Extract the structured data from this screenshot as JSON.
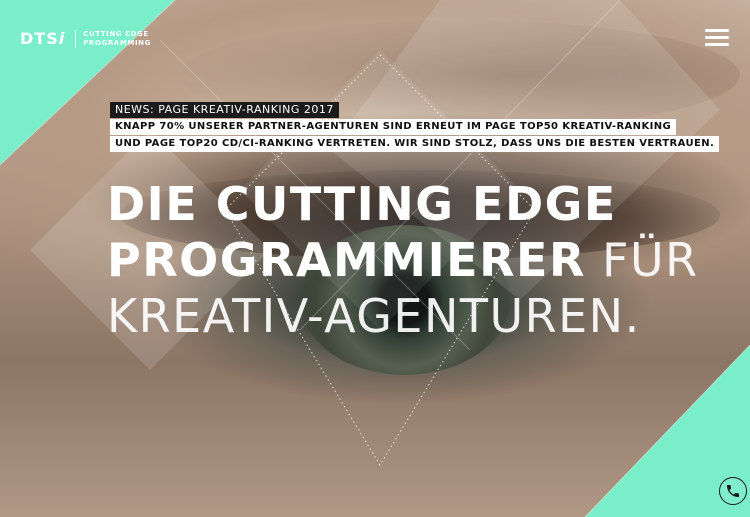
{
  "brand": {
    "logo_text": "DTS",
    "logo_i": "i",
    "tagline_line1": "CUTTING EDGE",
    "tagline_line2": "PROGRAMMING"
  },
  "nav": {
    "menu_icon": "hamburger-icon"
  },
  "news": {
    "tag": "NEWS: PAGE KREATIV-RANKING 2017",
    "line1": "KNAPP 70% UNSERER PARTNER-AGENTUREN SIND ERNEUT IM PAGE TOP50 KREATIV-RANKING",
    "line2": "UND PAGE TOP20 CD/CI-RANKING VERTRETEN. WIR SIND STOLZ, DASS UNS DIE BESTEN VERTRAUEN."
  },
  "hero": {
    "line1": "DIE CUTTING EDGE",
    "line2_bold": "PROGRAMMIERER",
    "line2_light": " FÜR",
    "line3": "KREATIV-AGENTUREN."
  },
  "contact": {
    "phone_icon": "phone-icon"
  },
  "colors": {
    "accent": "#7aeec9",
    "text_light": "#ffffff",
    "news_tag_bg": "#1b1b1b"
  }
}
